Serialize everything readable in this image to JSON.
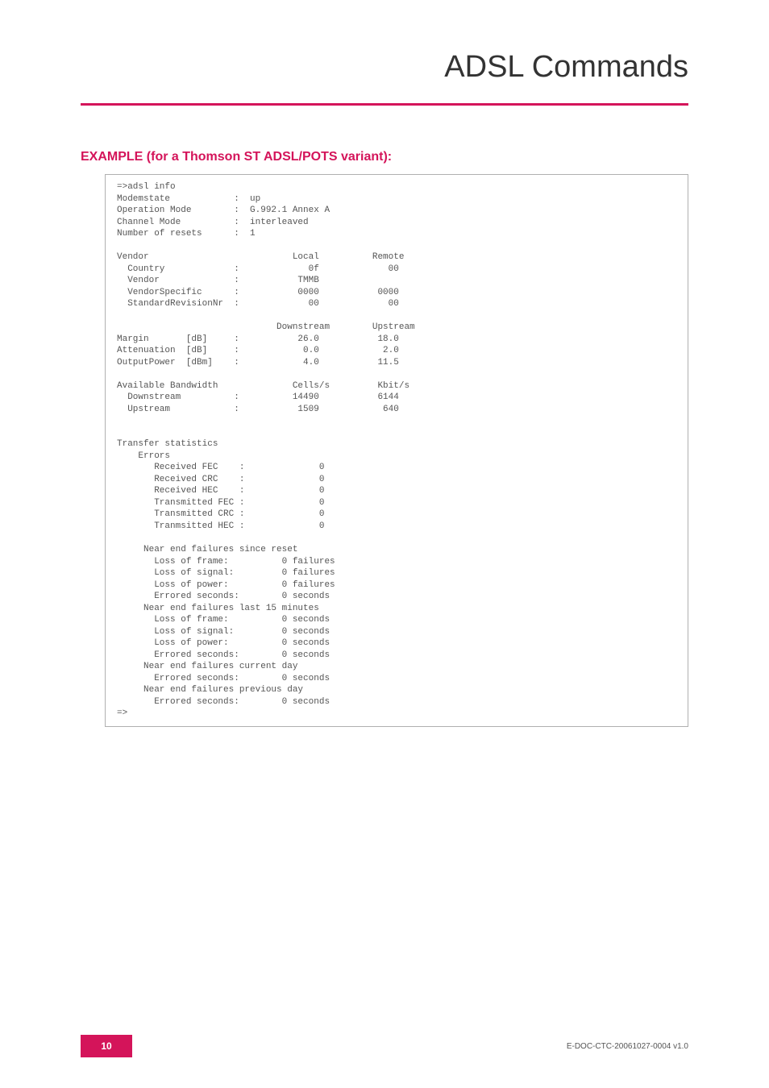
{
  "header": {
    "chapter_title": "ADSL Commands"
  },
  "section": {
    "heading": "EXAMPLE (for a Thomson ST ADSL/POTS variant):"
  },
  "code_output": "=>adsl info\nModemstate            :  up\nOperation Mode        :  G.992.1 Annex A\nChannel Mode          :  interleaved\nNumber of resets      :  1\n\nVendor                           Local          Remote\n  Country             :             0f             00\n  Vendor              :           TMMB\n  VendorSpecific      :           0000           0000\n  StandardRevisionNr  :             00             00\n\n                              Downstream        Upstream\nMargin       [dB]     :           26.0           18.0\nAttenuation  [dB]     :            0.0            2.0\nOutputPower  [dBm]    :            4.0           11.5\n\nAvailable Bandwidth              Cells/s         Kbit/s\n  Downstream          :          14490           6144\n  Upstream            :           1509            640\n\n\nTransfer statistics\n    Errors\n       Received FEC    :              0\n       Received CRC    :              0\n       Received HEC    :              0\n       Transmitted FEC :              0\n       Transmitted CRC :              0\n       Tranmsitted HEC :              0\n\n     Near end failures since reset\n       Loss of frame:          0 failures\n       Loss of signal:         0 failures\n       Loss of power:          0 failures\n       Errored seconds:        0 seconds\n     Near end failures last 15 minutes\n       Loss of frame:          0 seconds\n       Loss of signal:         0 seconds\n       Loss of power:          0 seconds\n       Errored seconds:        0 seconds\n     Near end failures current day\n       Errored seconds:        0 seconds\n     Near end failures previous day\n       Errored seconds:        0 seconds\n=>",
  "footer": {
    "page_number": "10",
    "doc_id": "E-DOC-CTC-20061027-0004 v1.0"
  }
}
